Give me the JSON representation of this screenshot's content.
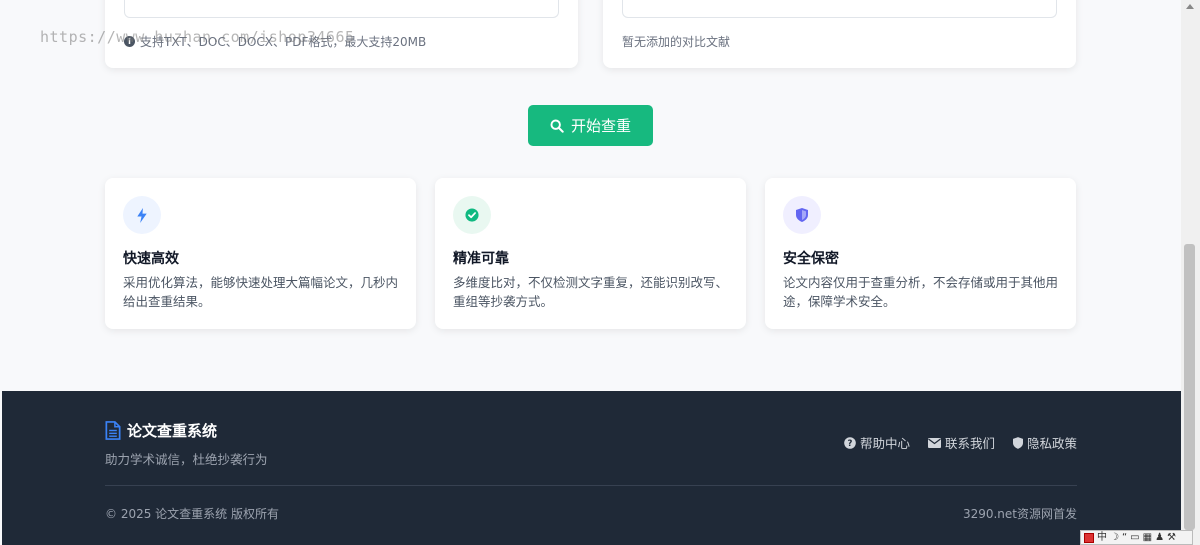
{
  "upload_hint": "支持TXT、DOC、DOCX、PDF格式，最大支持20MB",
  "compare_empty": "暂无添加的对比文献",
  "watermark": "https://www.huzhan.com/ishop34665",
  "start_button": "开始查重",
  "features": [
    {
      "title": "快速高效",
      "desc": "采用优化算法，能够快速处理大篇幅论文，几秒内给出查重结果。",
      "icon": "bolt-icon",
      "color": "#3b82f6",
      "bg": "#eef4ff"
    },
    {
      "title": "精准可靠",
      "desc": "多维度比对，不仅检测文字重复，还能识别改写、重组等抄袭方式。",
      "icon": "check-circle-icon",
      "color": "#10b981",
      "bg": "#e9f8f1"
    },
    {
      "title": "安全保密",
      "desc": "论文内容仅用于查重分析，不会存储或用于其他用途，保障学术安全。",
      "icon": "shield-icon",
      "color": "#6366f1",
      "bg": "#f0efff"
    }
  ],
  "footer": {
    "brand": "论文查重系统",
    "tagline": "助力学术诚信，杜绝抄袭行为",
    "links": [
      "帮助中心",
      "联系我们",
      "隐私政策"
    ],
    "copyright": "© 2025 论文查重系统 版权所有",
    "site_link": "3290.net资源网首发"
  },
  "ime": {
    "lang": "中"
  }
}
